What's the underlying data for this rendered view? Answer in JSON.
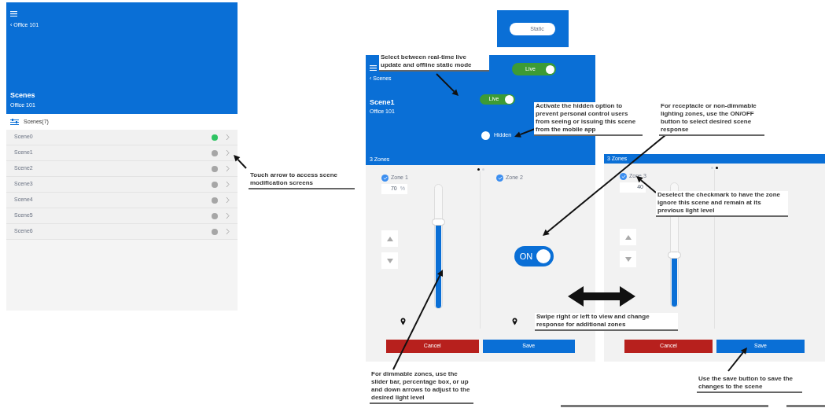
{
  "scene_list_screen": {
    "back_label": "‹ Office 101",
    "title": "Scenes",
    "subtitle": "Office 101",
    "list_header": "Scenes(7)",
    "scenes": [
      {
        "name": "Scene0",
        "color": "#2fc463"
      },
      {
        "name": "Scene1",
        "color": "#a6a6a6"
      },
      {
        "name": "Scene2",
        "color": "#a6a6a6"
      },
      {
        "name": "Scene3",
        "color": "#a6a6a6"
      },
      {
        "name": "Scene4",
        "color": "#a6a6a6"
      },
      {
        "name": "Scene5",
        "color": "#a6a6a6"
      },
      {
        "name": "Scene6",
        "color": "#a6a6a6"
      }
    ]
  },
  "static_toggle_inset": {
    "label": "Static",
    "on": false
  },
  "scene_screen": {
    "live_toggle_inset": {
      "label": "Live",
      "on": true
    },
    "back_label": "‹ Scenes",
    "title": "Scene1",
    "subtitle": "Office 101",
    "mode_toggle": {
      "label": "Live",
      "on": true
    },
    "hidden_toggle": {
      "label": "Hidden",
      "on": false
    },
    "zone_count": "3 Zones",
    "pages": [
      {
        "selected": true
      },
      {
        "selected": false
      }
    ],
    "zones": [
      {
        "kind": "dimmer",
        "name": "Zone 1",
        "checked": true,
        "percent": "70",
        "unit": "%",
        "level": 0.7
      },
      {
        "kind": "switch",
        "name": "Zone 2",
        "checked": true,
        "switch_label": "ON",
        "on": true
      }
    ],
    "cancel": "Cancel",
    "save": "Save"
  },
  "next_zone_screen": {
    "zone_count": "3 Zones",
    "pages": [
      {
        "selected": false
      },
      {
        "selected": true
      }
    ],
    "zones": [
      {
        "kind": "dimmer",
        "name": "Zone 3",
        "checked": true,
        "percent": "40",
        "level": 0.42
      }
    ],
    "cancel": "Cancel",
    "save": "Save"
  },
  "callouts": [
    "Touch arrow to access scene modification screens",
    "Select between real-time live update and offline static mode",
    "Activate the hidden option to prevent personal control users from seeing or issuing this scene from the mobile app",
    "For receptacle or non-dimmable lighting zones, use the ON/OFF button to select desired scene response",
    "Deselect the checkmark to have the zone ignore this scene and remain at its previous light level",
    "Swipe right or left to view and change response for additional zones",
    "For dimmable zones, use the slider bar, percentage box, or up and down arrows to adjust to the desired light level",
    "Use the save button to save the changes to the scene"
  ]
}
